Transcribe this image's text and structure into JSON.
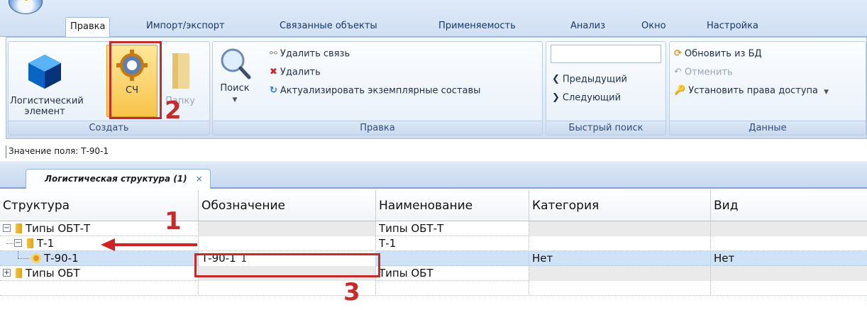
{
  "menu": {
    "tabs": [
      "Правка",
      "Импорт/экспорт",
      "Связанные объекты",
      "Применяемость",
      "Анализ",
      "Окно",
      "Настройка"
    ],
    "active_tab": "Правка"
  },
  "ribbon": {
    "create": {
      "logistic_element": "Логистический элемент",
      "sch": "СЧ",
      "folder": "Папку",
      "label": "Создать"
    },
    "edit": {
      "search": "Поиск",
      "delete_link": "Удалить связь",
      "delete": "Удалить",
      "actualize": "Актуализировать экземплярные составы",
      "label": "Правка"
    },
    "quick_search": {
      "prev": "Предыдущий",
      "next": "Следующий",
      "label": "Быстрый поиск",
      "input_value": ""
    },
    "data": {
      "refresh": "Обновить из БД",
      "undo": "Отменить",
      "set_access": "Установить права доступа",
      "label": "Данные"
    }
  },
  "field_value": "Значение поля:  Т-90-1",
  "doc_tab": {
    "label": "Логистическая структура (1)",
    "close": "×"
  },
  "grid": {
    "columns": [
      "Структура",
      "Обозначение",
      "Наименование",
      "Категория",
      "Вид"
    ],
    "rows": [
      {
        "structure": "Типы ОБТ-Т",
        "designation": "",
        "name": "Типы ОБТ-Т",
        "category": "",
        "type": "",
        "expander": "−"
      },
      {
        "structure": "Т-1",
        "designation": "",
        "name": "Т-1",
        "category": "",
        "type": "",
        "expander": "−"
      },
      {
        "structure": "Т-90-1",
        "designation": "Т-90-1",
        "name": "",
        "category": "Нет",
        "type": "Нет",
        "expander": ""
      },
      {
        "structure": "Типы ОБТ",
        "designation": "",
        "name": "Типы ОБТ",
        "category": "",
        "type": "",
        "expander": "+"
      },
      {
        "structure": "",
        "designation": "",
        "name": "",
        "category": "",
        "type": "",
        "expander": ""
      }
    ]
  },
  "annotations": [
    "1",
    "2",
    "3"
  ],
  "colors": {
    "accent_red": "#c62b2b",
    "selection": "#cfe2f7",
    "ribbon_blue": "#dce8f7"
  }
}
